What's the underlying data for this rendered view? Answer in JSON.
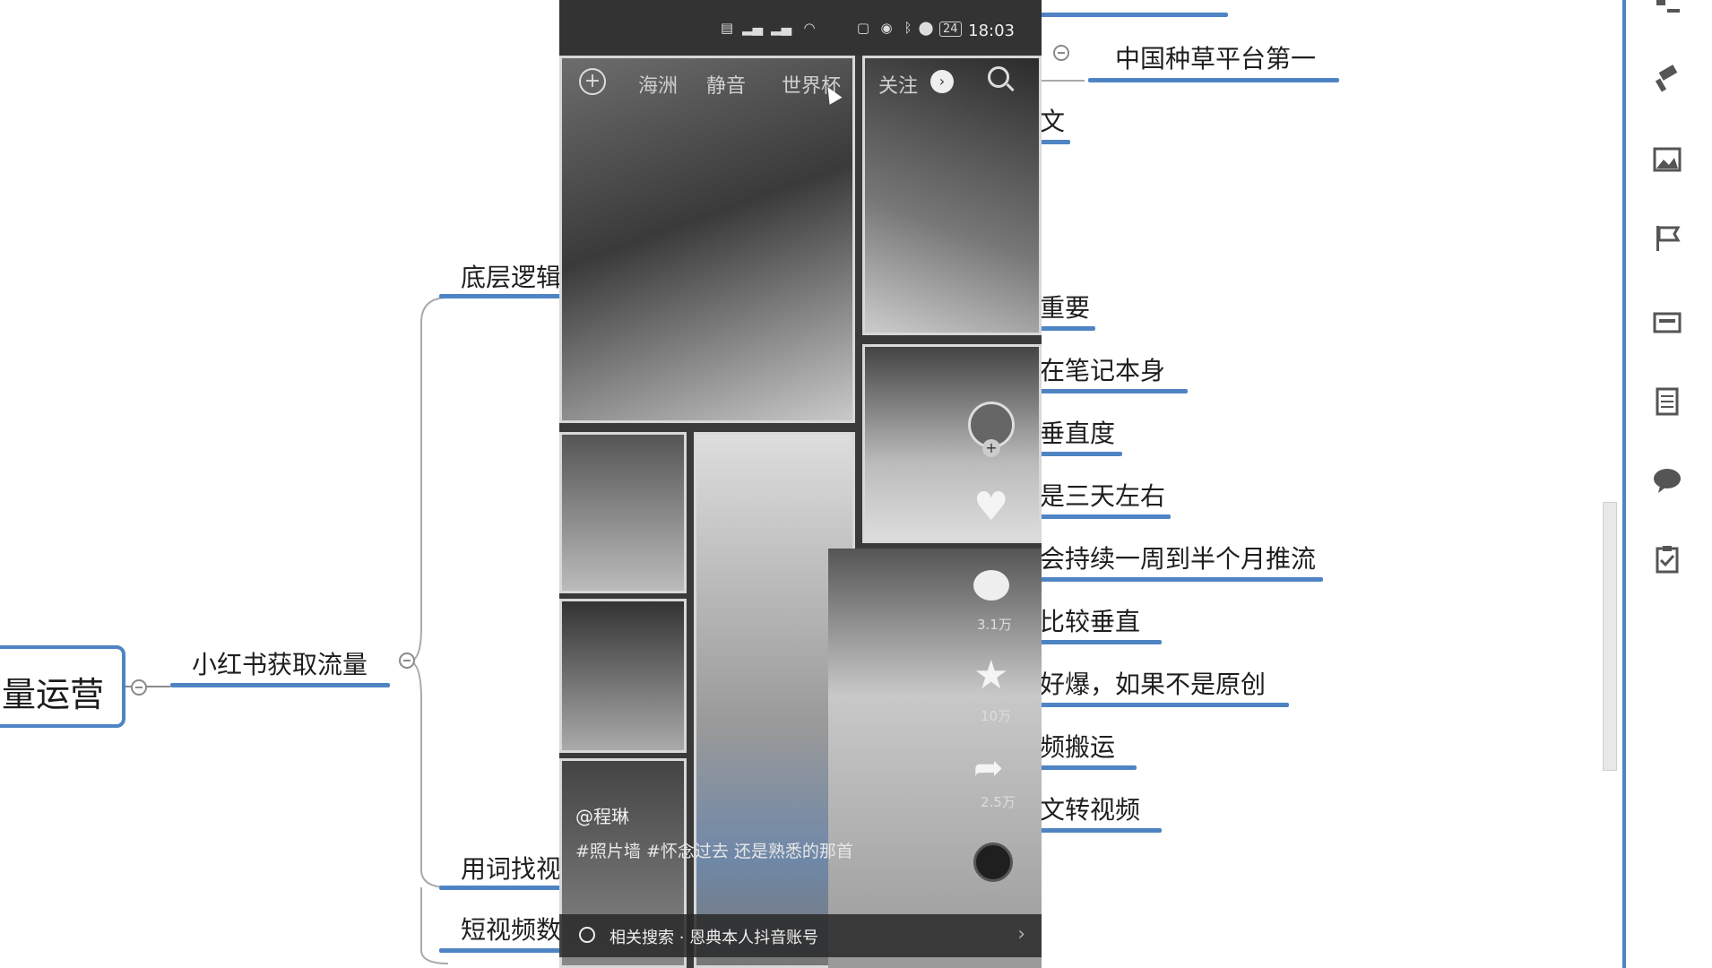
{
  "mindmap": {
    "root_label": "量运营",
    "branch_label": "小红书获取流量",
    "left_nodes": [
      {
        "label": "底层逻辑"
      },
      {
        "label": "用词找视"
      },
      {
        "label": "短视频数"
      }
    ],
    "right_nodes": [
      {
        "label": "中国种草平台第一"
      },
      {
        "label": "文"
      },
      {
        "label": "重要"
      },
      {
        "label": "在笔记本身"
      },
      {
        "label": "垂直度"
      },
      {
        "label": "是三天左右"
      },
      {
        "label": "会持续一周到半个月推流"
      },
      {
        "label": "比较垂直"
      },
      {
        "label": "好爆，如果不是原创"
      },
      {
        "label": "频搬运"
      },
      {
        "label": "文转视频"
      }
    ]
  },
  "phone": {
    "status_time": "18:03",
    "battery": "24",
    "tabs": [
      "海洲",
      "静音",
      "世界杯",
      "关注"
    ],
    "like_count": "3.1万",
    "favorite_count": "10万",
    "share_count": "2.5万",
    "username": "@程琳",
    "caption": "#照片墙 #怀念过去 还是熟悉的那首",
    "related_search": "相关搜索 · 恩典本人抖音账号"
  }
}
